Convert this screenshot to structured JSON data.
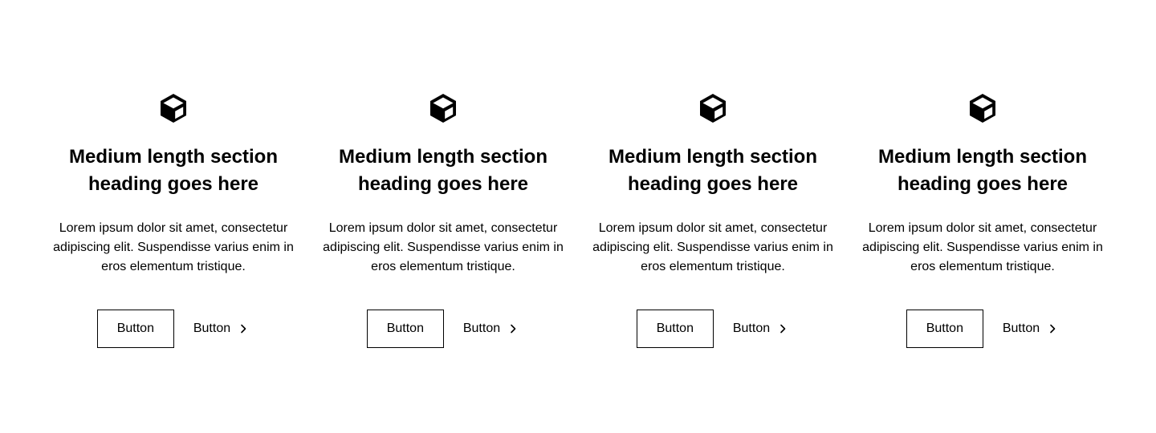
{
  "features": [
    {
      "icon": "cube-icon",
      "heading_line1": "Medium length section",
      "heading_line2": "heading goes here",
      "body": "Lorem ipsum dolor sit amet, consectetur adipiscing elit. Suspendisse varius enim in eros elementum tristique.",
      "primary_button": "Button",
      "link_button": "Button",
      "link_icon": "chevron-right-icon"
    },
    {
      "icon": "cube-icon",
      "heading_line1": "Medium length section",
      "heading_line2": "heading goes here",
      "body": "Lorem ipsum dolor sit amet, consectetur adipiscing elit. Suspendisse varius enim in eros elementum tristique.",
      "primary_button": "Button",
      "link_button": "Button",
      "link_icon": "chevron-right-icon"
    },
    {
      "icon": "cube-icon",
      "heading_line1": "Medium length section",
      "heading_line2": "heading goes here",
      "body": "Lorem ipsum dolor sit amet, consectetur adipiscing elit. Suspendisse varius enim in eros elementum tristique.",
      "primary_button": "Button",
      "link_button": "Button",
      "link_icon": "chevron-right-icon"
    },
    {
      "icon": "cube-icon",
      "heading_line1": "Medium length section",
      "heading_line2": "heading goes here",
      "body": "Lorem ipsum dolor sit amet, consectetur adipiscing elit. Suspendisse varius enim in eros elementum tristique.",
      "primary_button": "Button",
      "link_button": "Button",
      "link_icon": "chevron-right-icon"
    }
  ],
  "colors": {
    "text": "#000000",
    "background": "#ffffff",
    "border": "#000000"
  }
}
